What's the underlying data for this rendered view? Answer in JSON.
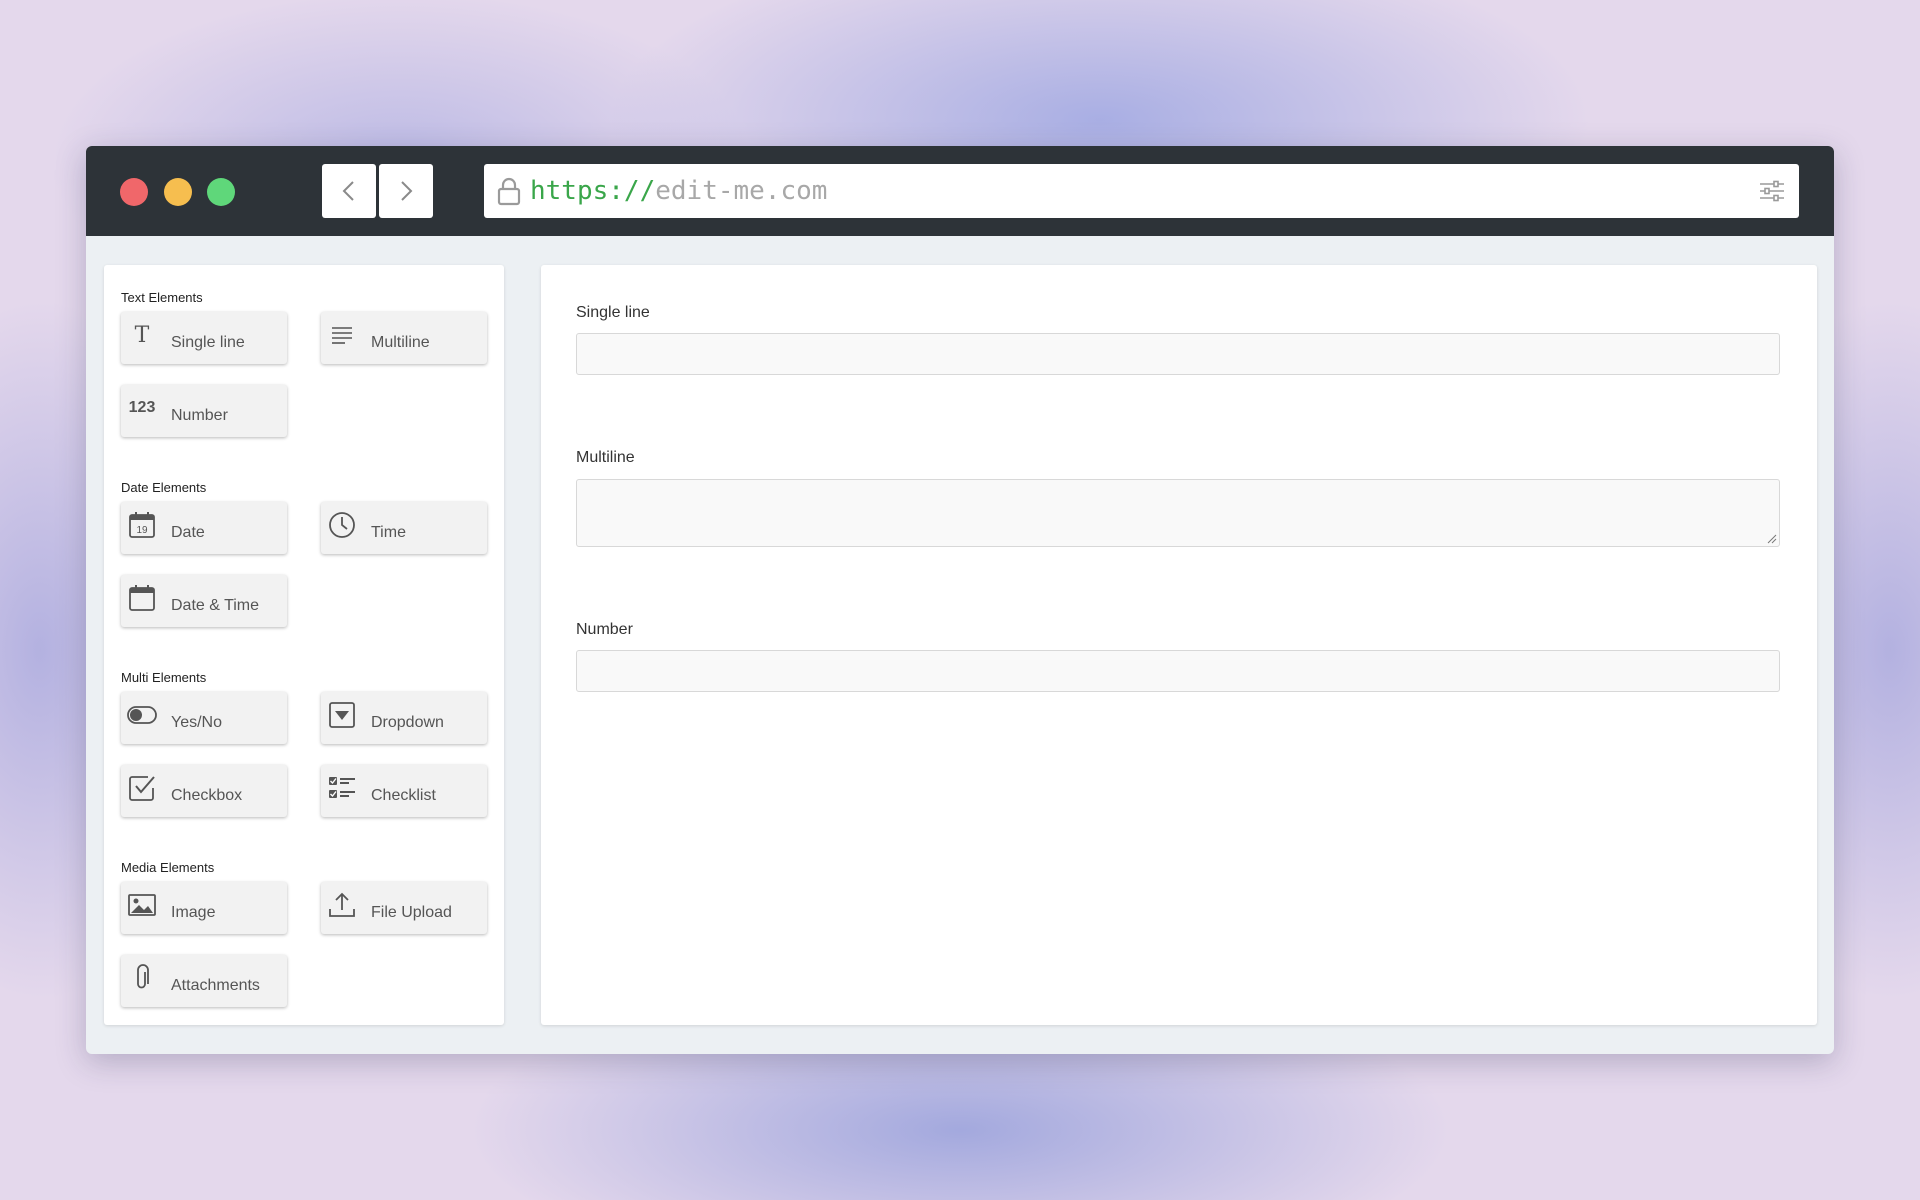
{
  "browser": {
    "url_scheme": "https://",
    "url_host": "edit-me.com"
  },
  "sidebar": {
    "sections": [
      {
        "title": "Text Elements",
        "items": [
          {
            "label": "Single line",
            "icon": "text-t-icon"
          },
          {
            "label": "Multiline",
            "icon": "lines-icon"
          },
          {
            "label": "Number",
            "icon": "number-icon",
            "icon_text": "123"
          }
        ]
      },
      {
        "title": "Date Elements",
        "items": [
          {
            "label": "Date",
            "icon": "calendar-date-icon",
            "icon_text": "19"
          },
          {
            "label": "Time",
            "icon": "clock-icon"
          },
          {
            "label": "Date & Time",
            "icon": "calendar-icon"
          }
        ]
      },
      {
        "title": "Multi Elements",
        "items": [
          {
            "label": "Yes/No",
            "icon": "toggle-icon"
          },
          {
            "label": "Dropdown",
            "icon": "dropdown-icon"
          },
          {
            "label": "Checkbox",
            "icon": "checkbox-icon"
          },
          {
            "label": "Checklist",
            "icon": "checklist-icon"
          }
        ]
      },
      {
        "title": "Media Elements",
        "items": [
          {
            "label": "Image",
            "icon": "image-icon"
          },
          {
            "label": "File Upload",
            "icon": "upload-icon"
          },
          {
            "label": "Attachments",
            "icon": "paperclip-icon"
          }
        ]
      }
    ]
  },
  "form": {
    "fields": [
      {
        "label": "Single line",
        "type": "text",
        "value": ""
      },
      {
        "label": "Multiline",
        "type": "textarea",
        "value": ""
      },
      {
        "label": "Number",
        "type": "number",
        "value": ""
      }
    ]
  },
  "colors": {
    "titlebar": "#2d3338",
    "close": "#f0676a",
    "minimize": "#f6be4f",
    "maximize": "#5fd77a",
    "url_scheme": "#3aa64a",
    "url_host": "#a8a8a8"
  }
}
